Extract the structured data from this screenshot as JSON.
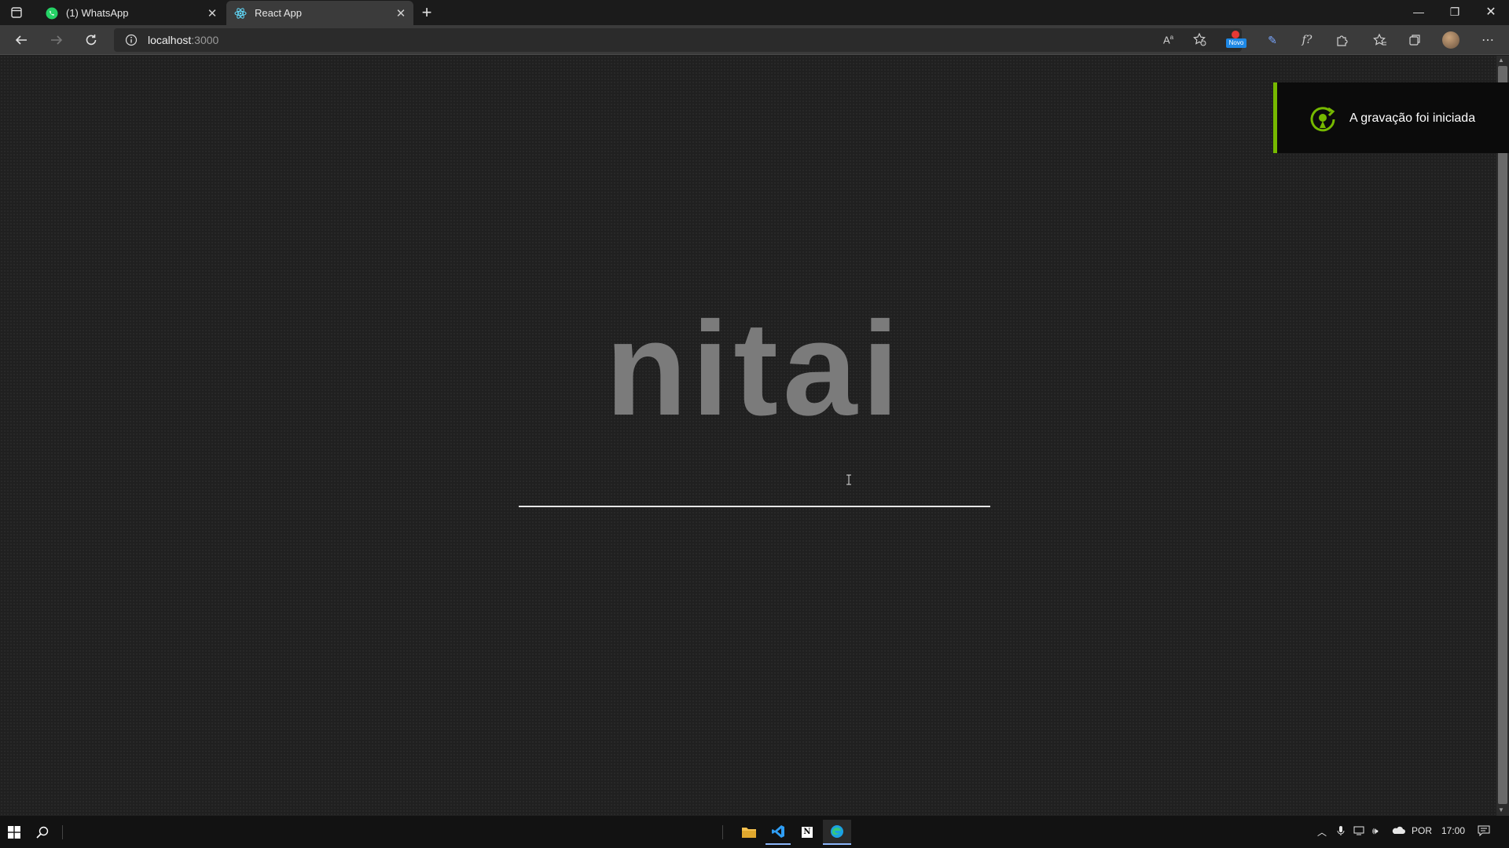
{
  "browser": {
    "tabs": [
      {
        "label": "(1) WhatsApp",
        "icon": "whatsapp-icon",
        "active": false
      },
      {
        "label": "React App",
        "icon": "react-icon",
        "active": true
      }
    ],
    "new_tab_symbol": "+",
    "address": {
      "host": "localhost",
      "port": ":3000"
    },
    "badge": "Novo"
  },
  "page": {
    "logo_text": "nitai"
  },
  "toast": {
    "message": "A gravação foi iniciada",
    "accent": "#76b900"
  },
  "taskbar": {
    "language": "POR",
    "time": "17:00"
  }
}
